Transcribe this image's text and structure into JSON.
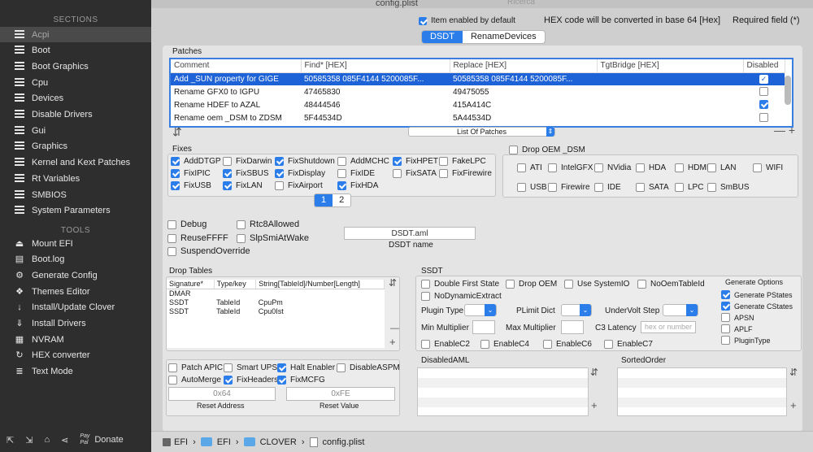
{
  "sidebar": {
    "sections_title": "SECTIONS",
    "sections": [
      "Acpi",
      "Boot",
      "Boot Graphics",
      "Cpu",
      "Devices",
      "Disable Drivers",
      "Gui",
      "Graphics",
      "Kernel and Kext Patches",
      "Rt Variables",
      "SMBIOS",
      "System Parameters"
    ],
    "tools_title": "TOOLS",
    "tools": [
      "Mount EFI",
      "Boot.log",
      "Generate Config",
      "Themes Editor",
      "Install/Update Clover",
      "Install Drivers",
      "NVRAM",
      "HEX converter",
      "Text Mode"
    ],
    "donate_label": "Donate",
    "paypal_label": "Pay Pal"
  },
  "window": {
    "title": "config.plist",
    "search_placeholder": "Ricerca"
  },
  "header": {
    "item_enabled": "Item enabled by default",
    "hex_note": "HEX code will be converted in base 64 [Hex]",
    "required_note": "Required field (*)"
  },
  "tabs": [
    "DSDT",
    "RenameDevices"
  ],
  "patches": {
    "title": "Patches",
    "columns": [
      "Comment",
      "Find* [HEX]",
      "Replace [HEX]",
      "TgtBridge [HEX]",
      "Disabled"
    ],
    "rows": [
      {
        "comment": "Add _SUN property for GIGE",
        "find": "50585358 085F4144 5200085F...",
        "replace": "50585358 085F4144 5200085F...",
        "tgt": "",
        "disabled": true
      },
      {
        "comment": "Rename GFX0 to IGPU",
        "find": "47465830",
        "replace": "49475055",
        "tgt": "",
        "disabled": false
      },
      {
        "comment": "Rename HDEF to AZAL",
        "find": "48444546",
        "replace": "415A414C",
        "tgt": "",
        "disabled": true
      },
      {
        "comment": "Rename oem _DSM to ZDSM",
        "find": "5F44534D",
        "replace": "5A44534D",
        "tgt": "",
        "disabled": false
      }
    ],
    "list_popup": "List Of Patches"
  },
  "fixes": {
    "title": "Fixes",
    "items": [
      {
        "label": "AddDTGP",
        "on": true
      },
      {
        "label": "FixDarwin",
        "on": false
      },
      {
        "label": "FixShutdown",
        "on": true
      },
      {
        "label": "AddMCHC",
        "on": false
      },
      {
        "label": "FixHPET",
        "on": true
      },
      {
        "label": "FakeLPC",
        "on": false
      },
      {
        "label": "FixIPIC",
        "on": true
      },
      {
        "label": "FixSBUS",
        "on": true
      },
      {
        "label": "FixDisplay",
        "on": true
      },
      {
        "label": "FixIDE",
        "on": false
      },
      {
        "label": "FixSATA",
        "on": false
      },
      {
        "label": "FixFirewire",
        "on": false
      },
      {
        "label": "FixUSB",
        "on": true
      },
      {
        "label": "FixLAN",
        "on": true
      },
      {
        "label": "FixAirport",
        "on": false
      },
      {
        "label": "FixHDA",
        "on": true
      }
    ],
    "pages": [
      "1",
      "2"
    ]
  },
  "drop_oem": {
    "label": "Drop OEM _DSM",
    "items": [
      "ATI",
      "IntelGFX",
      "NVidia",
      "HDA",
      "HDMI",
      "LAN",
      "WIFI",
      "USB",
      "Firewire",
      "IDE",
      "SATA",
      "LPC",
      "SmBUS"
    ]
  },
  "misc": {
    "items": [
      {
        "label": "Debug",
        "on": false
      },
      {
        "label": "Rtc8Allowed",
        "on": false
      },
      {
        "label": "ReuseFFFF",
        "on": false
      },
      {
        "label": "SlpSmiAtWake",
        "on": false
      },
      {
        "label": "SuspendOverride",
        "on": false
      }
    ],
    "dsdt_name_value": "DSDT.aml",
    "dsdt_name_label": "DSDT name"
  },
  "drop_tables": {
    "title": "Drop Tables",
    "columns": [
      "Signature*",
      "Type/key",
      "String[TableId]/Number[Length]"
    ],
    "rows": [
      [
        "DMAR",
        "",
        ""
      ],
      [
        "SSDT",
        "TableId",
        "CpuPm"
      ],
      [
        "SSDT",
        "TableId",
        "Cpu0Ist"
      ]
    ]
  },
  "bottom_opts": {
    "items": [
      {
        "label": "Patch APIC",
        "on": false
      },
      {
        "label": "Smart UPS",
        "on": false
      },
      {
        "label": "Halt Enabler",
        "on": true
      },
      {
        "label": "DisableASPM",
        "on": false
      },
      {
        "label": "AutoMerge",
        "on": false
      },
      {
        "label": "FixHeaders",
        "on": true
      },
      {
        "label": "FixMCFG",
        "on": true
      }
    ],
    "reset_address_value": "0x64",
    "reset_address_label": "Reset Address",
    "reset_value_value": "0xFE",
    "reset_value_label": "Reset Value"
  },
  "ssdt": {
    "title": "SSDT",
    "checks": [
      {
        "label": "Double First State",
        "on": false
      },
      {
        "label": "Drop OEM",
        "on": false
      },
      {
        "label": "Use SystemIO",
        "on": false
      },
      {
        "label": "NoOemTableId",
        "on": false
      },
      {
        "label": "NoDynamicExtract",
        "on": false
      }
    ],
    "plugin_type": "Plugin Type",
    "plimit": "PLimit Dict",
    "undervolt": "UnderVolt Step",
    "min_mult": "Min Multiplier",
    "max_mult": "Max Multiplier",
    "c3": "C3 Latency",
    "c3_placeholder": "hex or number",
    "enable": [
      {
        "label": "EnableC2",
        "on": false
      },
      {
        "label": "EnableC4",
        "on": false
      },
      {
        "label": "EnableC6",
        "on": false
      },
      {
        "label": "EnableC7",
        "on": false
      }
    ],
    "generate_title": "Generate Options",
    "generate": [
      {
        "label": "Generate PStates",
        "on": true
      },
      {
        "label": "Generate CStates",
        "on": true
      },
      {
        "label": "APSN",
        "on": false
      },
      {
        "label": "APLF",
        "on": false
      },
      {
        "label": "PluginType",
        "on": false
      }
    ]
  },
  "disabled_aml": "DisabledAML",
  "sorted_order": "SortedOrder",
  "pathbar": [
    "EFI",
    "EFI",
    "CLOVER",
    "config.plist"
  ]
}
